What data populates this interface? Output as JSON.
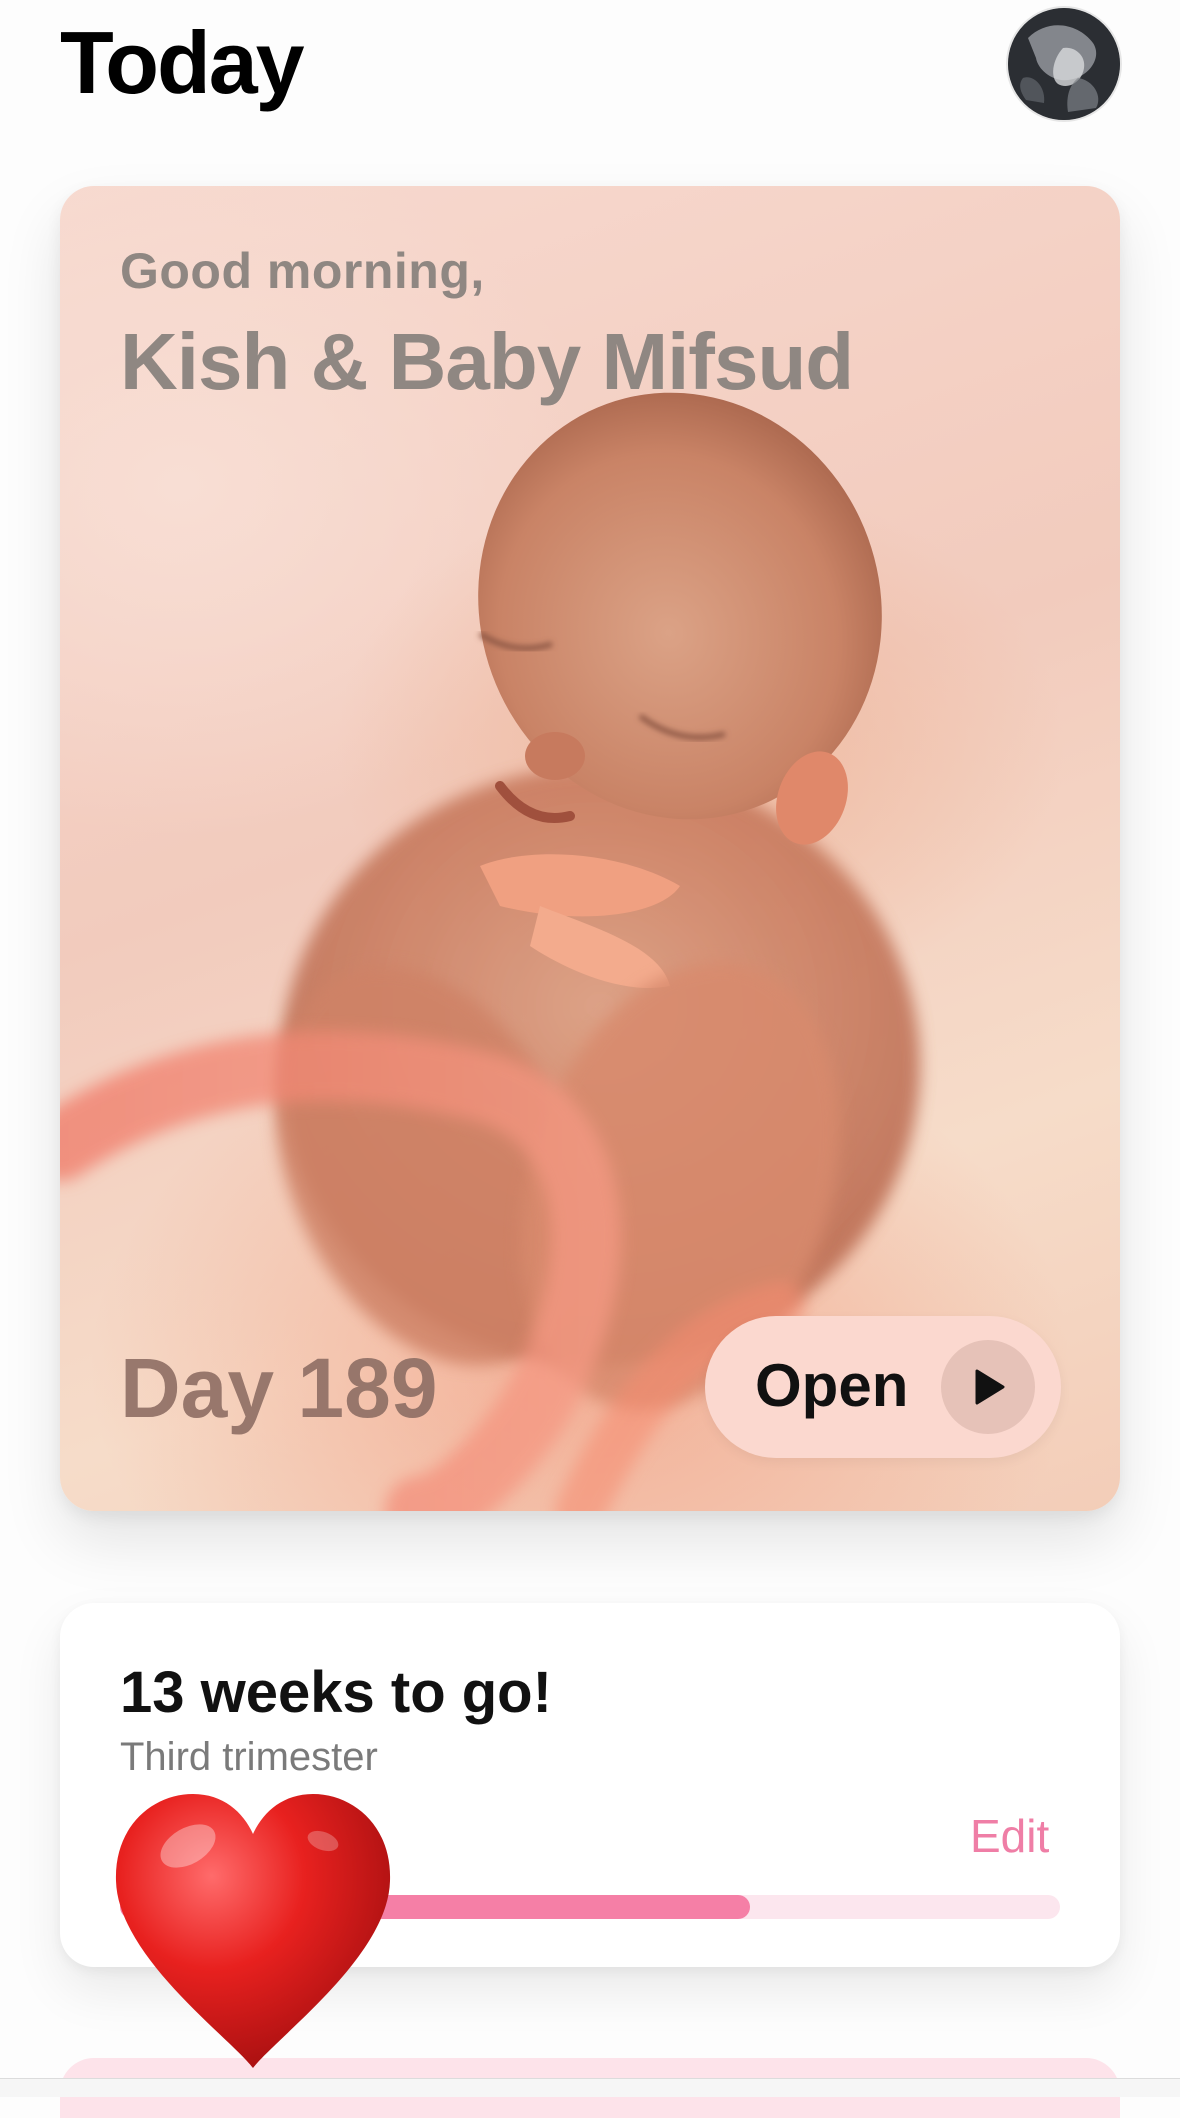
{
  "header": {
    "title": "Today",
    "avatar_icon": "profile-avatar"
  },
  "hero": {
    "greeting": "Good morning,",
    "names": "Kish & Baby Mifsud",
    "day_label": "Day 189",
    "open_label": "Open",
    "play_icon": "play-icon"
  },
  "progress": {
    "title": "13 weeks to go!",
    "subtitle": "Third trimester",
    "progress_label": "",
    "edit_label": "Edit",
    "accent_color": "#f57fa6",
    "track_color": "#fce6ee",
    "fraction": 0.67
  },
  "sticker": {
    "icon": "red-heart-icon"
  }
}
